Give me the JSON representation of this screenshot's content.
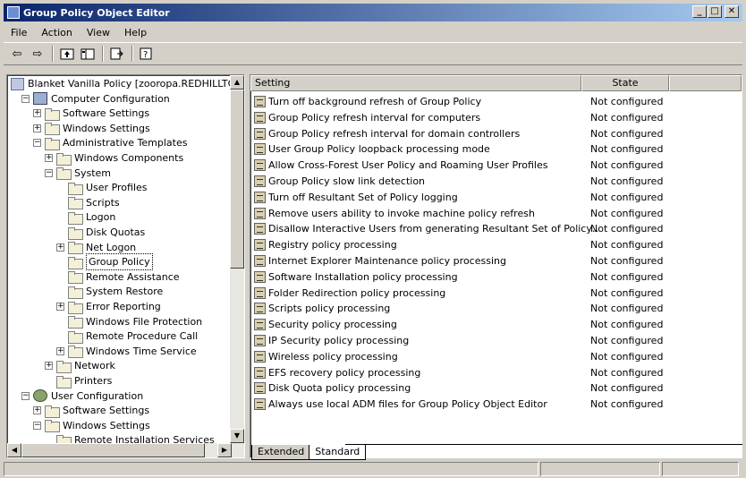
{
  "window": {
    "title": "Group Policy Object Editor",
    "controls": [
      "_",
      "□",
      "✕"
    ]
  },
  "menu": [
    "File",
    "Action",
    "View",
    "Help"
  ],
  "toolbar": [
    "back-icon",
    "forward-icon",
    "up-icon",
    "show-hide-tree-icon",
    "export-list-icon",
    "help-icon"
  ],
  "tree": [
    {
      "label": "Blanket Vanilla Policy [zooropa.REDHILLTOW",
      "level": 0,
      "icon": "policy-icon",
      "expander": ""
    },
    {
      "label": "Computer Configuration",
      "level": 1,
      "icon": "computer-icon",
      "expander": "−"
    },
    {
      "label": "Software Settings",
      "level": 2,
      "icon": "folder-icon",
      "expander": "+"
    },
    {
      "label": "Windows Settings",
      "level": 2,
      "icon": "folder-icon",
      "expander": "+"
    },
    {
      "label": "Administrative Templates",
      "level": 2,
      "icon": "folder-icon",
      "expander": "−"
    },
    {
      "label": "Windows Components",
      "level": 3,
      "icon": "folder-icon",
      "expander": "+"
    },
    {
      "label": "System",
      "level": 3,
      "icon": "folder-icon",
      "expander": "−"
    },
    {
      "label": "User Profiles",
      "level": 4,
      "icon": "folder-icon",
      "expander": ""
    },
    {
      "label": "Scripts",
      "level": 4,
      "icon": "folder-icon",
      "expander": ""
    },
    {
      "label": "Logon",
      "level": 4,
      "icon": "folder-icon",
      "expander": ""
    },
    {
      "label": "Disk Quotas",
      "level": 4,
      "icon": "folder-icon",
      "expander": ""
    },
    {
      "label": "Net Logon",
      "level": 4,
      "icon": "folder-icon",
      "expander": "+"
    },
    {
      "label": "Group Policy",
      "level": 4,
      "icon": "folder-open-icon",
      "expander": "",
      "selected": true
    },
    {
      "label": "Remote Assistance",
      "level": 4,
      "icon": "folder-icon",
      "expander": ""
    },
    {
      "label": "System Restore",
      "level": 4,
      "icon": "folder-icon",
      "expander": ""
    },
    {
      "label": "Error Reporting",
      "level": 4,
      "icon": "folder-icon",
      "expander": "+"
    },
    {
      "label": "Windows File Protection",
      "level": 4,
      "icon": "folder-icon",
      "expander": ""
    },
    {
      "label": "Remote Procedure Call",
      "level": 4,
      "icon": "folder-icon",
      "expander": ""
    },
    {
      "label": "Windows Time Service",
      "level": 4,
      "icon": "folder-icon",
      "expander": "+"
    },
    {
      "label": "Network",
      "level": 3,
      "icon": "folder-icon",
      "expander": "+"
    },
    {
      "label": "Printers",
      "level": 3,
      "icon": "folder-icon",
      "expander": ""
    },
    {
      "label": "User Configuration",
      "level": 1,
      "icon": "user-icon",
      "expander": "−"
    },
    {
      "label": "Software Settings",
      "level": 2,
      "icon": "folder-icon",
      "expander": "+"
    },
    {
      "label": "Windows Settings",
      "level": 2,
      "icon": "folder-icon",
      "expander": "−"
    },
    {
      "label": "Remote Installation Services",
      "level": 3,
      "icon": "ris-icon",
      "expander": ""
    }
  ],
  "list": {
    "columns": [
      "Setting",
      "State"
    ],
    "rows": [
      {
        "setting": "Turn off background refresh of Group Policy",
        "state": "Not configured"
      },
      {
        "setting": "Group Policy refresh interval for computers",
        "state": "Not configured"
      },
      {
        "setting": "Group Policy refresh interval for domain controllers",
        "state": "Not configured"
      },
      {
        "setting": "User Group Policy loopback processing mode",
        "state": "Not configured"
      },
      {
        "setting": "Allow Cross-Forest User Policy and Roaming User Profiles",
        "state": "Not configured"
      },
      {
        "setting": "Group Policy slow link detection",
        "state": "Not configured"
      },
      {
        "setting": "Turn off Resultant Set of Policy logging",
        "state": "Not configured"
      },
      {
        "setting": "Remove users ability to invoke machine policy refresh",
        "state": "Not configured"
      },
      {
        "setting": "Disallow Interactive Users from generating Resultant Set of Policy…",
        "state": "Not configured"
      },
      {
        "setting": "Registry policy processing",
        "state": "Not configured"
      },
      {
        "setting": "Internet Explorer Maintenance policy processing",
        "state": "Not configured"
      },
      {
        "setting": "Software Installation policy processing",
        "state": "Not configured"
      },
      {
        "setting": "Folder Redirection policy processing",
        "state": "Not configured"
      },
      {
        "setting": "Scripts policy processing",
        "state": "Not configured"
      },
      {
        "setting": "Security policy processing",
        "state": "Not configured"
      },
      {
        "setting": "IP Security policy processing",
        "state": "Not configured"
      },
      {
        "setting": "Wireless policy processing",
        "state": "Not configured"
      },
      {
        "setting": "EFS recovery policy processing",
        "state": "Not configured"
      },
      {
        "setting": "Disk Quota policy processing",
        "state": "Not configured"
      },
      {
        "setting": "Always use local ADM files for Group Policy Object Editor",
        "state": "Not configured"
      }
    ]
  },
  "tabs": [
    {
      "label": "Extended",
      "active": false
    },
    {
      "label": "Standard",
      "active": true
    }
  ]
}
